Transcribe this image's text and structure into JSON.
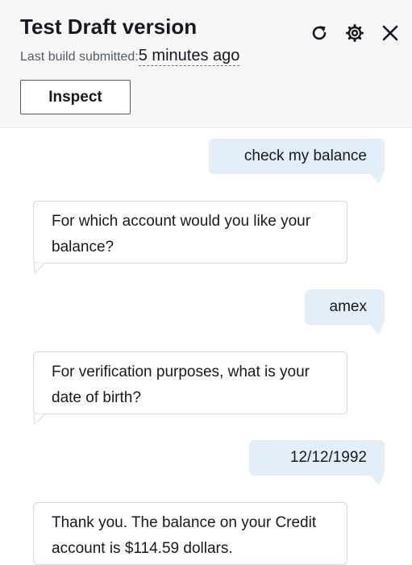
{
  "header": {
    "title": "Test Draft version",
    "build_label": "Last build submitted:",
    "build_time": "5 minutes ago",
    "inspect_label": "Inspect",
    "icons": [
      "refresh-icon",
      "settings-icon",
      "close-icon"
    ]
  },
  "conversation": [
    {
      "from": "user",
      "text": "check my balance"
    },
    {
      "from": "bot",
      "text": "For which account would you like your balance?"
    },
    {
      "from": "user",
      "text": "amex"
    },
    {
      "from": "bot",
      "text": "For verification purposes, what is your date of birth?"
    },
    {
      "from": "user",
      "text": "12/12/1992"
    },
    {
      "from": "bot",
      "text": "Thank you. The balance on your Credit account is $114.59 dollars."
    }
  ],
  "colors": {
    "header_bg": "#f7f7f7",
    "user_bubble": "#e3eef7",
    "bot_border": "#d5dbdb",
    "text": "#16191f"
  }
}
